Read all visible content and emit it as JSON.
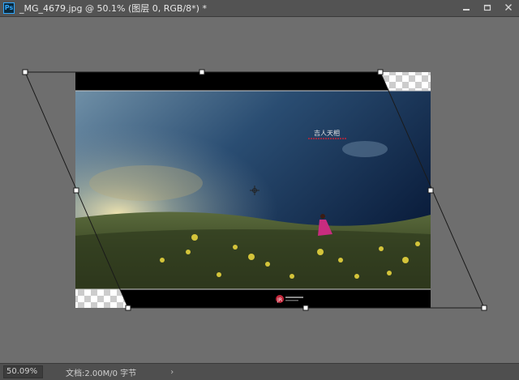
{
  "app": {
    "logo_text": "Ps",
    "document_title": "_MG_4679.jpg @ 50.1% (图层 0, RGB/8*) *"
  },
  "window_buttons": {
    "minimize": "▬",
    "restore": "☐",
    "close": "✕"
  },
  "image": {
    "watermark_text": "吉人天相",
    "footer_logo_text": "JR"
  },
  "status": {
    "zoom": "50.09%",
    "doc_info": "文档:2.00M/0 字节",
    "arrow": "›"
  },
  "colors": {
    "accent": "#31a8ff",
    "canvas_bg": "#6e6e6e",
    "chrome_bg": "#535353"
  }
}
